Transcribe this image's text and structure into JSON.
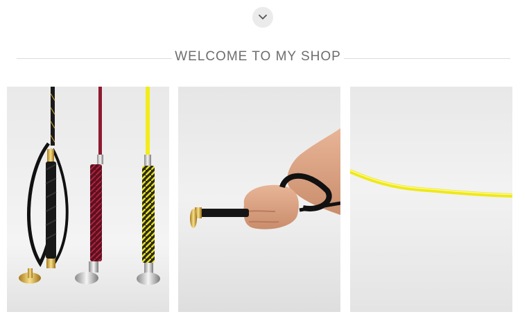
{
  "header": {
    "scroll_icon": "chevron-down-icon",
    "title": "WELCOME TO MY SHOP"
  },
  "gallery": {
    "photos": [
      {
        "subject": "three riding whips black red yellow"
      },
      {
        "subject": "hand holding whip with wrist loop"
      },
      {
        "subject": "yellow whip shaft closeup"
      }
    ]
  },
  "colors": {
    "heading": "#6d6d6d",
    "divider": "#dcdcdc",
    "button_bg": "#ebebeb",
    "whip_yellow": "#f2ec1a",
    "whip_red": "#9a1b34"
  }
}
